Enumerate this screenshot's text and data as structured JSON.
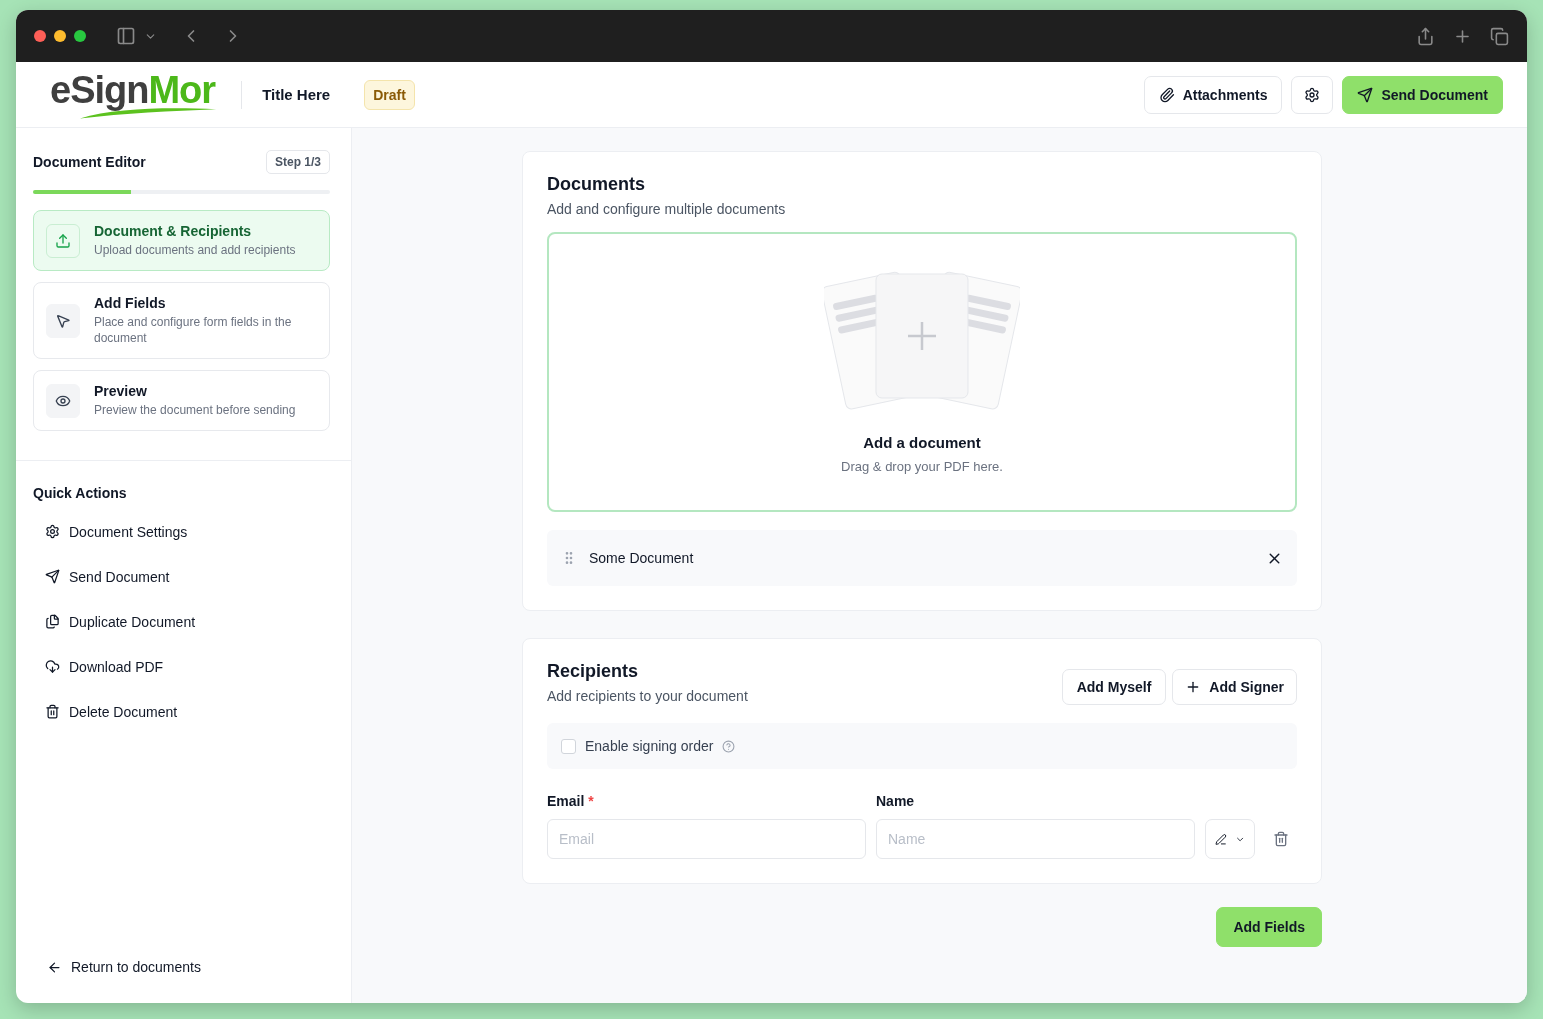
{
  "logo": {
    "dark": "eSign",
    "green": "Mor"
  },
  "header": {
    "title": "Title Here",
    "status": "Draft",
    "attachments": "Attachments",
    "send": "Send Document"
  },
  "sidebar": {
    "title": "Document Editor",
    "step": "Step 1/3",
    "progress": {
      "level": 0.33
    },
    "steps": [
      {
        "kind": "upload",
        "title": "Document & Recipients",
        "desc": "Upload documents and add recipients",
        "selected": true
      },
      {
        "kind": "pointer",
        "title": "Add Fields",
        "desc": "Place and configure form fields in the document",
        "selected": false
      },
      {
        "kind": "eye",
        "title": "Preview",
        "desc": "Preview the document before sending",
        "selected": false
      }
    ],
    "quick_title": "Quick Actions",
    "quick_actions": [
      {
        "kind": "settings",
        "label": "Document Settings"
      },
      {
        "kind": "send",
        "label": "Send Document"
      },
      {
        "kind": "copy",
        "label": "Duplicate Document"
      },
      {
        "kind": "download",
        "label": "Download PDF"
      },
      {
        "kind": "delete",
        "label": "Delete Document"
      }
    ],
    "return": "Return to documents"
  },
  "documents": {
    "title": "Documents",
    "subtitle": "Add and configure multiple documents",
    "drop_title": "Add a document",
    "drop_hint": "Drag & drop your PDF here.",
    "files": [
      "Some Document"
    ]
  },
  "recipients": {
    "title": "Recipients",
    "subtitle": "Add recipients to your document",
    "add_myself": "Add Myself",
    "add_signer": "Add Signer",
    "signing_order": {
      "label": "Enable signing order",
      "checked": false
    },
    "email_label": "Email",
    "required": "*",
    "name_label": "Name",
    "email_placeholder": "Email",
    "name_placeholder": "Name"
  },
  "next": "Add Fields"
}
